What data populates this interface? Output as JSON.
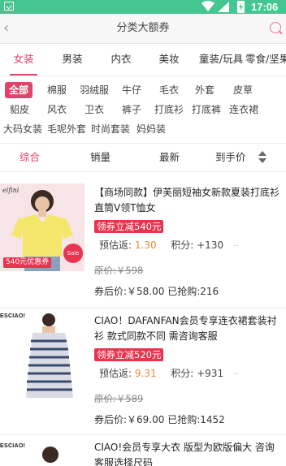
{
  "status_bar": {
    "time": "17:06",
    "icons": [
      "notification-check-icon",
      "wifi-icon",
      "signal-icon",
      "battery-charging-icon"
    ]
  },
  "title_bar": {
    "title": "分类大额券",
    "back_icon": "chevron-left-icon",
    "search_icon": "search-icon"
  },
  "categories": [
    "女装",
    "男装",
    "内衣",
    "美妆",
    "童装/玩具",
    "零食/坚果"
  ],
  "active_category": "女装",
  "subcategories": {
    "row1": [
      "全部",
      "棉服",
      "羽绒服",
      "牛仔",
      "毛衣",
      "外套",
      "皮草"
    ],
    "row2": [
      "貂皮",
      "风衣",
      "卫衣",
      "裤子",
      "打底衫",
      "打底裤",
      "连衣裙"
    ],
    "row3": [
      "大码女装",
      "毛呢外套",
      "时尚套装",
      "妈妈装"
    ],
    "active": "全部"
  },
  "sort": {
    "options": [
      "综合",
      "销量",
      "最新",
      "到手价"
    ],
    "active": "综合"
  },
  "products": [
    {
      "title": "【商场同款】伊芙丽短袖女新款夏装打底衫直筒V领T恤女",
      "coupon": "领券立减540元",
      "estimate_label": "预估返:",
      "estimate_value": "1.30",
      "points_label": "积分:",
      "points_value": "+130",
      "original_price": "原价:￥598",
      "after_label": "券后价:",
      "after_price": "￥58.00",
      "sold": "已抢购:216",
      "image_badge": "540元优惠券",
      "brand_mark": "eifini",
      "tag_text": "Sale",
      "shirt_color": "#f4e66a"
    },
    {
      "title": "CIAO！DAFANFAN会员专享连衣裙套装衬衫 款式同款不同 需咨询客服",
      "coupon": "领券立减520元",
      "estimate_label": "预估返:",
      "estimate_value": "9.31",
      "points_label": "积分:",
      "points_value": "+931",
      "original_price": "原价:￥589",
      "after_label": "券后价:",
      "after_price": "￥69.00",
      "sold": "已抢购:1452",
      "brand_mark": "ESCIAO!"
    },
    {
      "title": "CIAO!会员专享大衣 版型为欧版偏大 咨询客服选择尺码",
      "brand_mark": "ESCIAO!"
    }
  ],
  "colors": {
    "status_bar": "#45c58f",
    "accent": "#e0436c",
    "coupon": "#e8344e",
    "rebate": "#f08a3a"
  }
}
